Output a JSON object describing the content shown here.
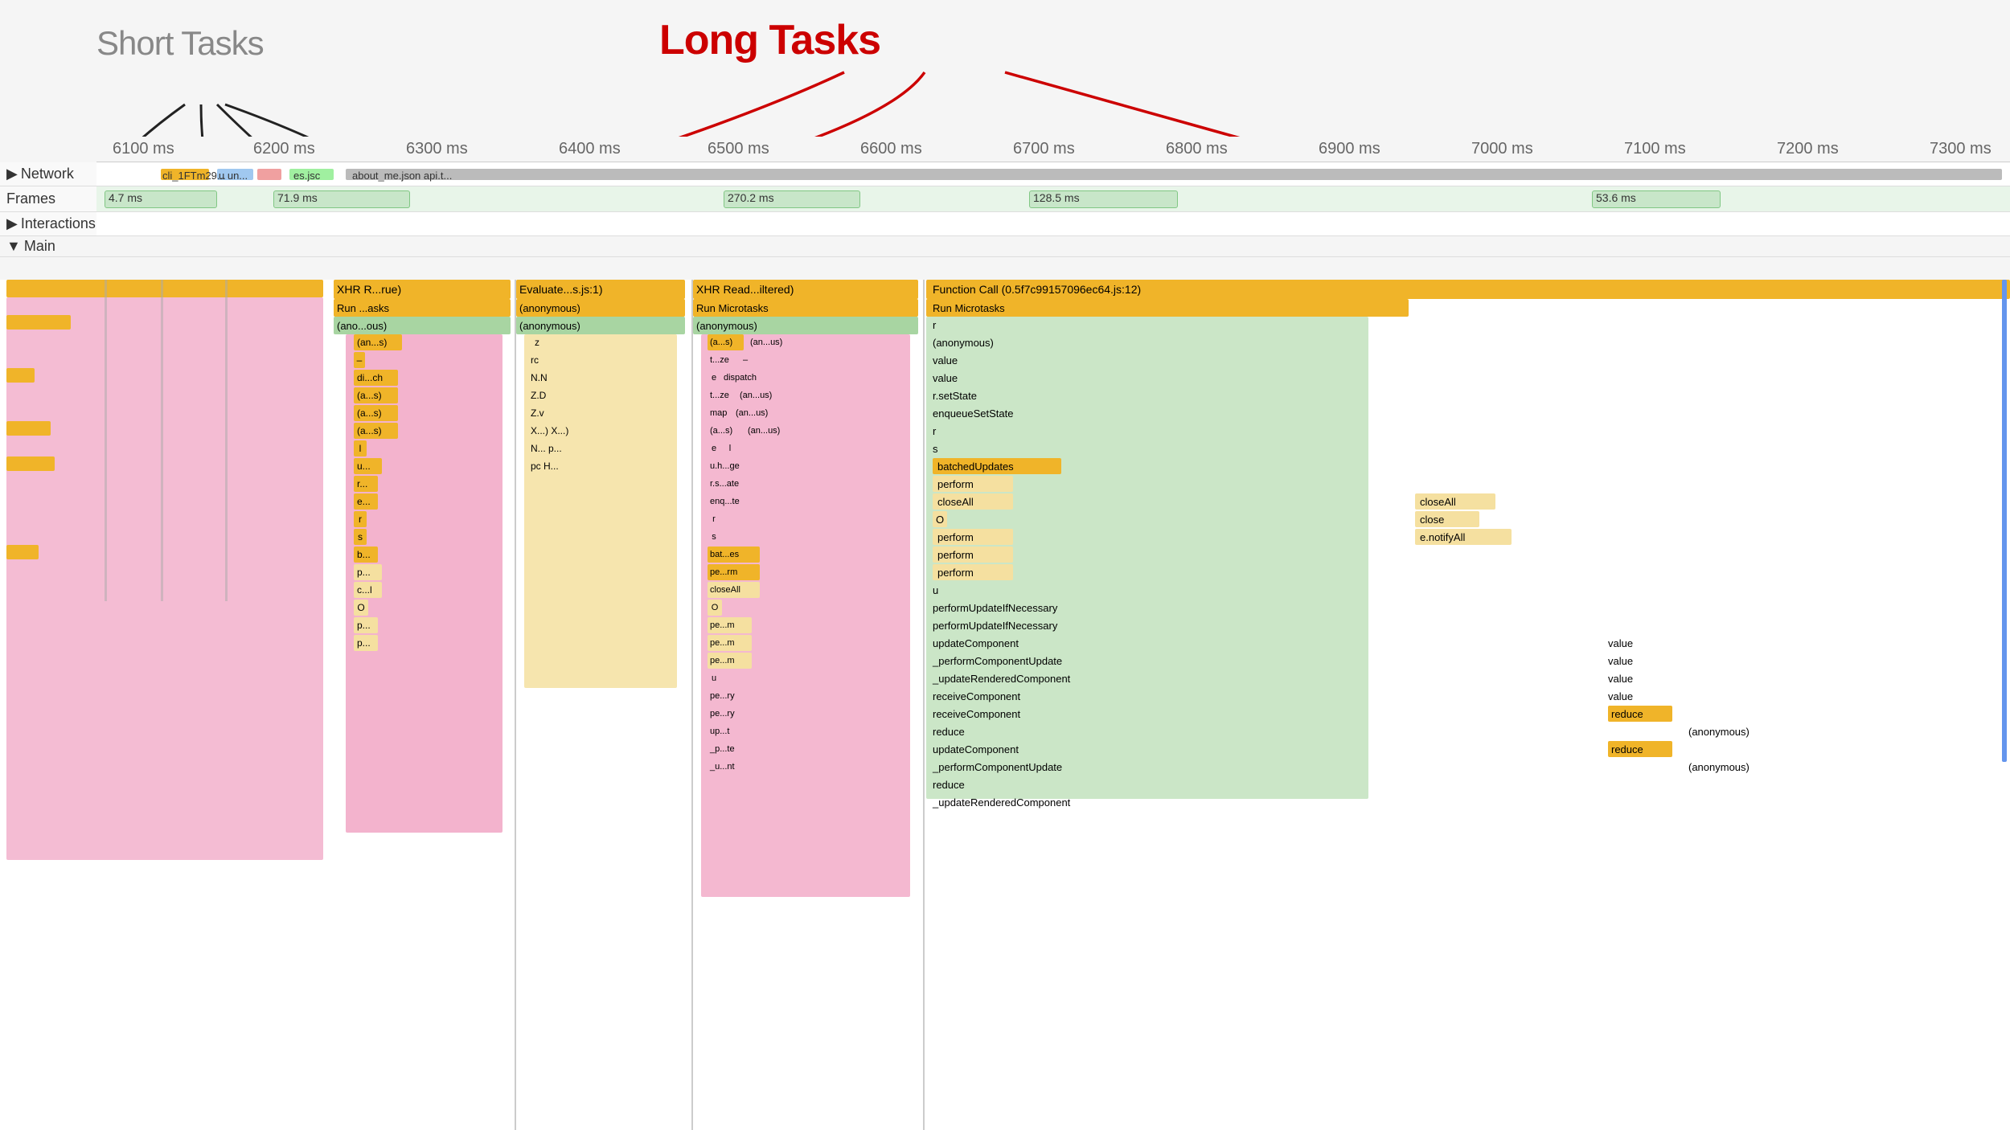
{
  "annotations": {
    "short_tasks_label": "Short Tasks",
    "long_tasks_label": "Long Tasks"
  },
  "time_ruler": {
    "ticks": [
      {
        "label": "6100 ms",
        "left_pct": 2
      },
      {
        "label": "6200 ms",
        "left_pct": 10
      },
      {
        "label": "6300 ms",
        "left_pct": 18
      },
      {
        "label": "6400 ms",
        "left_pct": 26
      },
      {
        "label": "6500 ms",
        "left_pct": 34
      },
      {
        "label": "6600 ms",
        "left_pct": 42
      },
      {
        "label": "6700 ms",
        "left_pct": 50
      },
      {
        "label": "6800 ms",
        "left_pct": 58
      },
      {
        "label": "6900 ms",
        "left_pct": 66
      },
      {
        "label": "7000 ms",
        "left_pct": 74
      },
      {
        "label": "7100 ms",
        "left_pct": 82
      },
      {
        "label": "7200 ms",
        "left_pct": 90
      },
      {
        "label": "7300 ms",
        "left_pct": 98
      }
    ]
  },
  "rows": {
    "network": "Network",
    "frames": "Frames",
    "interactions": "Interactions",
    "main": "Main"
  },
  "frame_times": [
    {
      "label": "4.7 ms",
      "left_pct": 3,
      "width_pct": 6
    },
    {
      "label": "71.9 ms",
      "left_pct": 11,
      "width_pct": 8
    },
    {
      "label": "270.2 ms",
      "left_pct": 34,
      "width_pct": 8
    },
    {
      "label": "128.5 ms",
      "left_pct": 50,
      "width_pct": 8
    },
    {
      "label": "53.6 ms",
      "left_pct": 74,
      "width_pct": 8
    }
  ],
  "call_stacks": {
    "left_section": {
      "top": "XHR R...rue)",
      "items": [
        "Run ...asks",
        "(ano...ous)",
        "(an...s)",
        "–",
        "di...ch",
        "(a...s)",
        "(a...s)",
        "(a...s)",
        "l",
        "u...",
        "r...",
        "e...",
        "r",
        "s",
        "b...",
        "p...",
        "c...l",
        "O",
        "p...",
        "p..."
      ]
    },
    "middle_left": {
      "top": "Evaluate...s.js:1)",
      "items": [
        "(anonymous)",
        "(anonymous)",
        "z",
        "rc",
        "N.N",
        "Z.D",
        "Z.v",
        "X...) X...)",
        "N... p...",
        "pc H..."
      ]
    },
    "middle_right": {
      "top": "XHR Read...iltered)",
      "items": [
        "Run Microtasks",
        "(anonymous)",
        "t...ze –",
        "e dispatch",
        "t...ze (an...us)",
        "map (an...us)",
        "(a...s) (an...us)",
        "e l",
        "u.h...ge",
        "r.s...ate",
        "enq...te",
        "r",
        "s",
        "bat...es",
        "pe...rm",
        "closeAll",
        "O",
        "pe...m",
        "pe...m",
        "pe...m",
        "u",
        "pe...ry",
        "pe...ry",
        "up...t",
        "_p...te",
        "_u...nt"
      ]
    },
    "right_section": {
      "top": "Function Call (0.5f7c99157096ec64.js:12)",
      "items": [
        "Run Microtasks",
        "r",
        "(anonymous)",
        "value",
        "value",
        "r.setState",
        "enqueueSetState",
        "r",
        "s",
        "batchedUpdates",
        "perform",
        "closeAll",
        "O",
        "perform",
        "perform",
        "perform",
        "u",
        "performUpdateIfNecessary",
        "performUpdateIfNecessary",
        "updateComponent",
        "_performComponentUpdate",
        "_updateRenderedComponent",
        "receiveComponent",
        "receiveComponent",
        "reduce",
        "updateComponent",
        "_performComponentUpdate",
        "reduce",
        "_updateRenderedComponent"
      ],
      "right_items": [
        "closeAll",
        "close",
        "e.notifyAll",
        "value",
        "value",
        "value",
        "value",
        "reduce",
        "(anonymous)",
        "reduce",
        "(anonymous)"
      ]
    }
  }
}
